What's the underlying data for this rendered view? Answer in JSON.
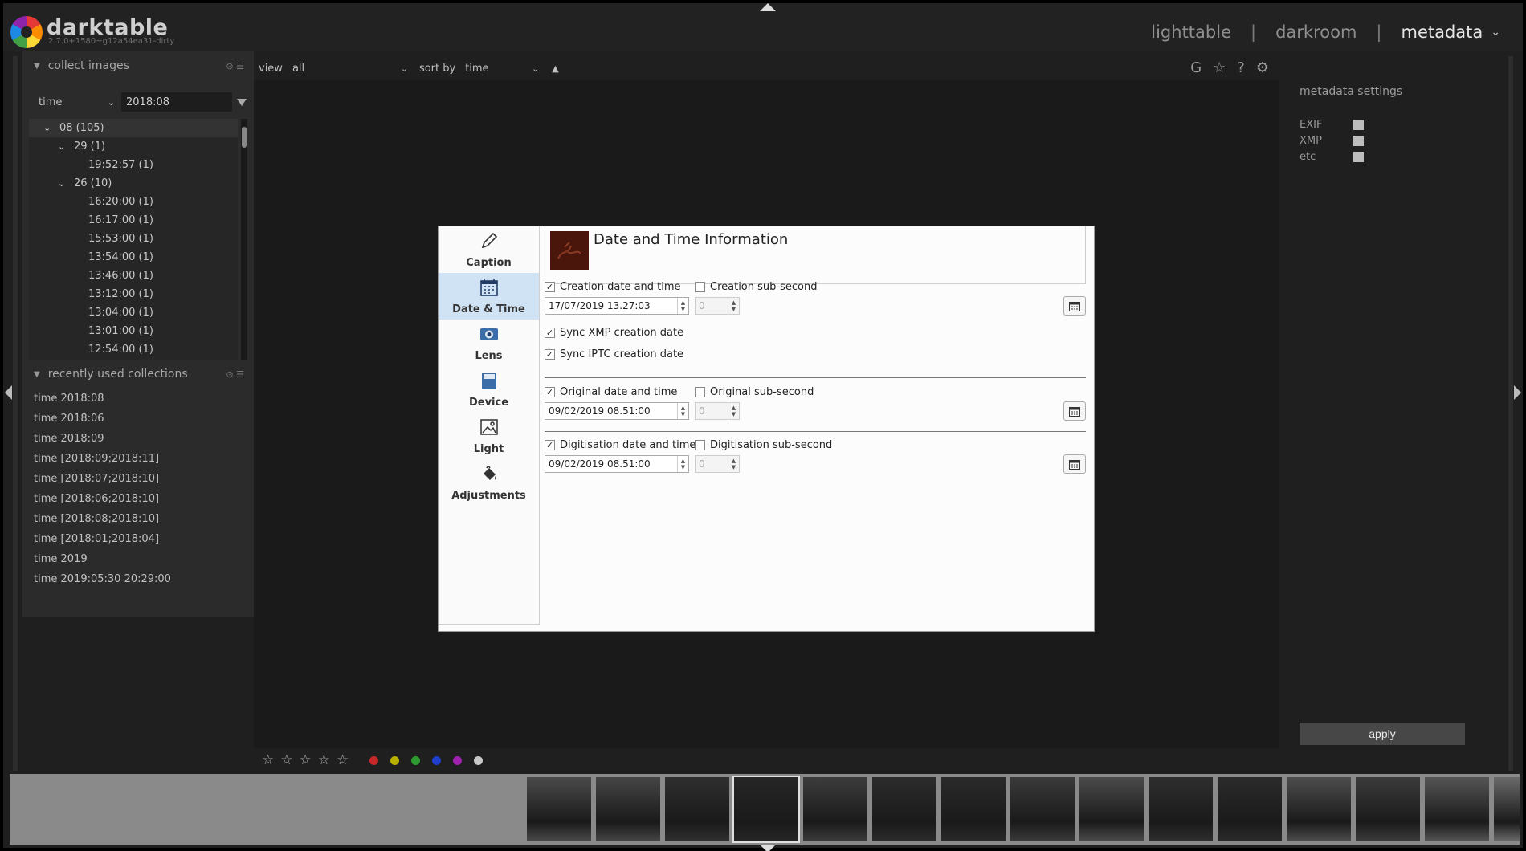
{
  "app": {
    "name": "darktable",
    "version": "2.7.0+1580~g12a54ea31-dirty",
    "views": [
      "lighttable",
      "darkroom",
      "metadata"
    ],
    "active_view": "metadata"
  },
  "collect": {
    "title": "collect images",
    "property": "time",
    "value": "2018:08",
    "tree": [
      {
        "label": "08 (105)",
        "level": 0,
        "expanded": true,
        "selected": true
      },
      {
        "label": "29 (1)",
        "level": 1,
        "expanded": true
      },
      {
        "label": "19:52:57 (1)",
        "level": 2
      },
      {
        "label": "26 (10)",
        "level": 1,
        "expanded": true
      },
      {
        "label": "16:20:00 (1)",
        "level": 2
      },
      {
        "label": "16:17:00 (1)",
        "level": 2
      },
      {
        "label": "15:53:00 (1)",
        "level": 2
      },
      {
        "label": "13:54:00 (1)",
        "level": 2
      },
      {
        "label": "13:46:00 (1)",
        "level": 2
      },
      {
        "label": "13:12:00 (1)",
        "level": 2
      },
      {
        "label": "13:04:00 (1)",
        "level": 2
      },
      {
        "label": "13:01:00 (1)",
        "level": 2
      },
      {
        "label": "12:54:00 (1)",
        "level": 2
      }
    ]
  },
  "recent": {
    "title": "recently used collections",
    "items": [
      "time 2018:08",
      "time 2018:06",
      "time 2018:09",
      "time [2018:09;2018:11]",
      "time [2018:07;2018:10]",
      "time [2018:06;2018:10]",
      "time [2018:08;2018:10]",
      "time [2018:01;2018:04]",
      "time 2019",
      "time 2019:05:30 20:29:00"
    ]
  },
  "toolbar": {
    "view_label": "view",
    "view_value": "all",
    "sort_label": "sort by",
    "sort_value": "time",
    "sort_dir": "▲",
    "icons": [
      "grouping-icon",
      "star-overlay-icon",
      "help-icon",
      "preferences-gear-icon"
    ]
  },
  "bottom": {
    "stars": 5,
    "color_labels": [
      "#c62828",
      "#b8b000",
      "#2e9b2e",
      "#1e3fc8",
      "#a020b0",
      "#c8c8c8"
    ]
  },
  "right": {
    "title": "metadata settings",
    "options": [
      "EXIF",
      "XMP",
      "etc"
    ],
    "apply_label": "apply"
  },
  "dialog": {
    "title": "Date and Time Information",
    "nav": [
      {
        "label": "Caption",
        "icon": "pencil-icon",
        "selected": false
      },
      {
        "label": "Date & Time",
        "icon": "calendar-icon",
        "selected": true
      },
      {
        "label": "Lens",
        "icon": "camera-lens-icon",
        "selected": false
      },
      {
        "label": "Device",
        "icon": "device-icon",
        "selected": false
      },
      {
        "label": "Light",
        "icon": "image-light-icon",
        "selected": false
      },
      {
        "label": "Adjustments",
        "icon": "paint-bucket-icon",
        "selected": false
      }
    ],
    "creation": {
      "label": "Creation date and time",
      "checked": true,
      "sub_label": "Creation sub-second",
      "sub_checked": false,
      "value": "17/07/2019 13.27:03",
      "sub_value": "0",
      "sync_xmp": "Sync XMP creation date",
      "sync_iptc": "Sync IPTC creation date"
    },
    "original": {
      "label": "Original date and time",
      "checked": true,
      "sub_label": "Original sub-second",
      "sub_checked": false,
      "value": "09/02/2019 08.51:00",
      "sub_value": "0"
    },
    "digitisation": {
      "label": "Digitisation date and time",
      "checked": true,
      "sub_label": "Digitisation sub-second",
      "sub_checked": false,
      "value": "09/02/2019 08.51:00",
      "sub_value": "0"
    }
  },
  "filmstrip": {
    "selected_index": 3,
    "thumbs": [
      "#4a4a4a",
      "#454545",
      "#2f2f2f",
      "#262626",
      "#3c3c3c",
      "#2c2c2c",
      "#2a2a2a",
      "#3a3a3a",
      "#4b4b4b",
      "#2e2e2e",
      "#2b2b2b",
      "#4d4d4d",
      "#3b3b3b",
      "#555555",
      "#6a6a6a"
    ]
  }
}
